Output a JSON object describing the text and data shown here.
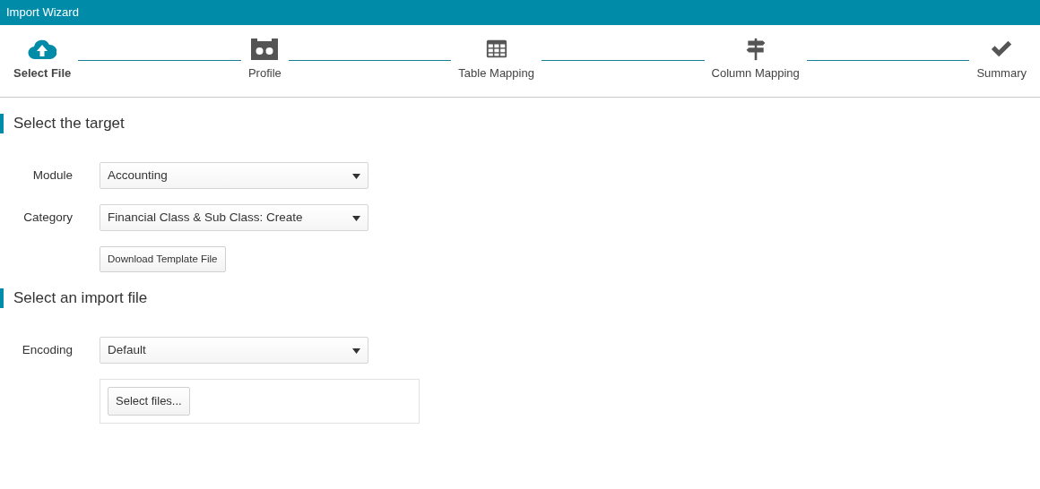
{
  "window": {
    "title": "Import Wizard"
  },
  "steps": [
    {
      "label": "Select File",
      "kind": "upload",
      "selected": true
    },
    {
      "label": "Profile",
      "kind": "profile",
      "selected": false
    },
    {
      "label": "Table Mapping",
      "kind": "table",
      "selected": false
    },
    {
      "label": "Column Mapping",
      "kind": "signpost",
      "selected": false
    },
    {
      "label": "Summary",
      "kind": "check",
      "selected": false
    }
  ],
  "sections": [
    {
      "title": "Select the target",
      "fields": [
        {
          "kind": "select",
          "label": "Module",
          "value": "Accounting"
        },
        {
          "kind": "select",
          "label": "Category",
          "value": "Financial Class & Sub Class: Create"
        },
        {
          "kind": "button",
          "label": "Download Template File"
        }
      ]
    },
    {
      "title": "Select an import file",
      "fields": [
        {
          "kind": "select",
          "label": "Encoding",
          "value": "Default"
        },
        {
          "kind": "upload",
          "label": "Select files..."
        }
      ]
    }
  ]
}
